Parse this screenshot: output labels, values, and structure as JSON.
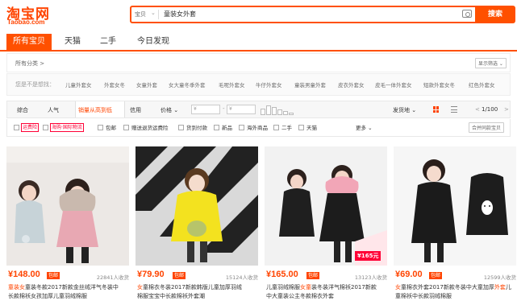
{
  "header": {
    "logo_cn": "淘宝网",
    "logo_en": "Taobao.com",
    "search_type": "宝贝",
    "search_query": "童装女外套",
    "search_button": "搜索"
  },
  "tabs": [
    {
      "label": "所有宝贝",
      "active": true
    },
    {
      "label": "天猫",
      "active": false
    },
    {
      "label": "二手",
      "active": false
    },
    {
      "label": "今日发现",
      "active": false
    }
  ],
  "filters": {
    "all_categories": "所有分类 >",
    "show_filter": "显示筛选 ⌄",
    "guess_label": "您是不是想找：",
    "suggestions": [
      "儿童外套女",
      "外套女冬",
      "女童外套",
      "女大童冬季外套",
      "毛呢外套女",
      "牛仔外套女",
      "童装男童外套",
      "皮衣外套女",
      "皮毛一体外套女",
      "短款外套女冬",
      "红色外套女"
    ]
  },
  "sort": {
    "items": [
      "综合",
      "人气",
      "销量从高到低",
      "信用",
      "价格 ⌄"
    ],
    "price_from": "¥",
    "price_to": "¥",
    "ship_from": "发货地 ⌄",
    "page": "1/100",
    "prev": "<",
    "next": ">"
  },
  "checkboxes": {
    "badge1": "运费险",
    "badge2": "海购·国际物流",
    "items": [
      "包邮",
      "赠送退货运费险",
      "货到付款",
      "新品",
      "海外商品",
      "二手",
      "天猫"
    ],
    "more": "更多 ⌄",
    "merge": "合并同款宝贝"
  },
  "products": [
    {
      "price": "¥148.00",
      "baoyou": "包邮",
      "sold": "22841人收货",
      "title_parts": [
        {
          "t": "童装女",
          "hl": true
        },
        {
          "t": "童装冬款2017新款金丝绒洋气冬装中",
          "hl": false
        }
      ],
      "title_line2": "长款棉袄女孩加厚儿童羽绒棉服"
    },
    {
      "price": "¥79.90",
      "baoyou": "包邮",
      "sold": "15124人收货",
      "title_parts": [
        {
          "t": "女",
          "hl": true
        },
        {
          "t": "童棉衣冬装2017新款韩版儿童加厚羽绒",
          "hl": false
        }
      ],
      "title_line2": "棉服宝宝中长款棉袄外套潮"
    },
    {
      "price": "¥165.00",
      "baoyou": "包邮",
      "sold": "13123人收货",
      "title_parts": [
        {
          "t": "儿童羽绒棉服",
          "hl": false
        },
        {
          "t": "女童",
          "hl": true
        },
        {
          "t": "装冬装洋气棉袄2017新款",
          "hl": false
        }
      ],
      "title_line2": "中大童装公主冬款棉衣外套",
      "promo": "¥165元"
    },
    {
      "price": "¥69.00",
      "baoyou": "包邮",
      "sold": "12599人收货",
      "title_parts": [
        {
          "t": "女",
          "hl": true
        },
        {
          "t": "童棉衣外套2017新款冬装中大童加厚",
          "hl": false
        },
        {
          "t": "外套",
          "hl": true
        },
        {
          "t": "儿",
          "hl": false
        }
      ],
      "title_line2": "童棉袄中长款羽绒棉服"
    }
  ],
  "colors": {
    "accent": "#ff5000",
    "price": "#ff4400"
  }
}
